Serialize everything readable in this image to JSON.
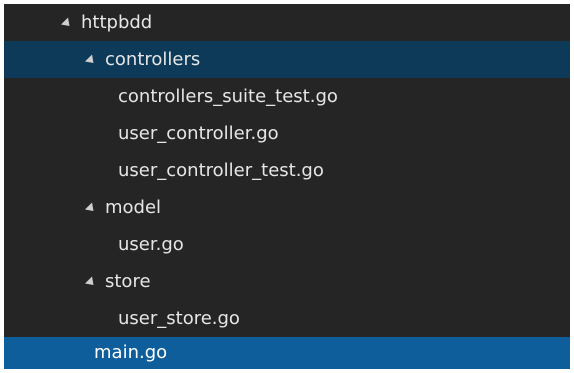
{
  "tree": {
    "root": {
      "label": "httpbdd",
      "icon": "triangle-down-icon"
    },
    "folders": [
      {
        "label": "controllers",
        "icon": "triangle-down-icon",
        "files": [
          "controllers_suite_test.go",
          "user_controller.go",
          "user_controller_test.go"
        ]
      },
      {
        "label": "model",
        "icon": "triangle-down-icon",
        "files": [
          "user.go"
        ]
      },
      {
        "label": "store",
        "icon": "triangle-down-icon",
        "files": [
          "user_store.go"
        ]
      }
    ],
    "root_files": [
      "main.go"
    ]
  },
  "colors": {
    "panel_background": "#252526",
    "hover_row": "#0d3a58",
    "selected_row": "#0e5e9c",
    "text": "#e6e6e6"
  }
}
